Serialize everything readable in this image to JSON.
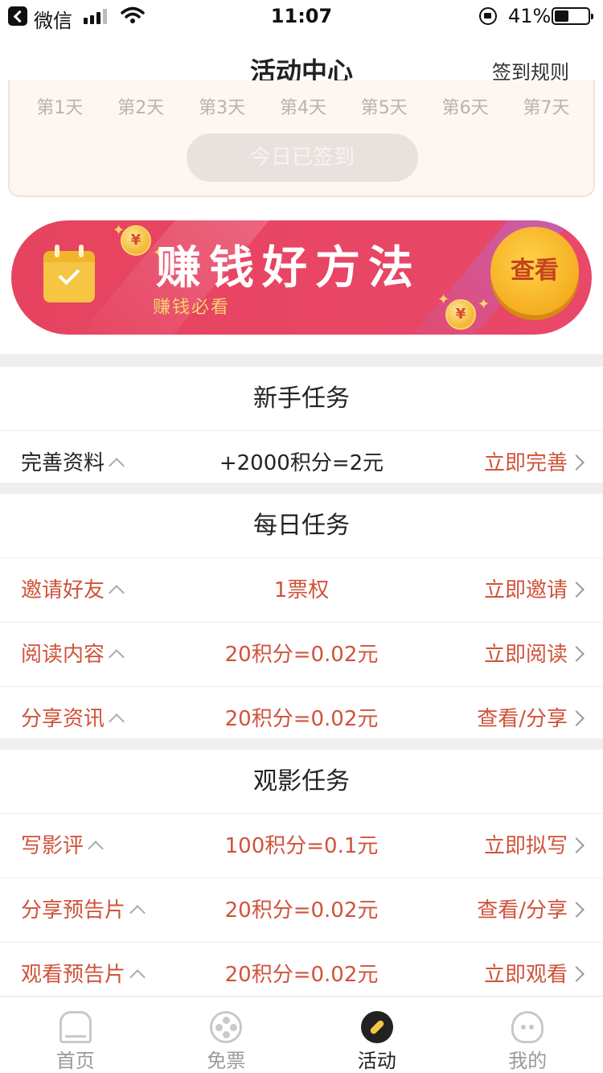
{
  "status_bar": {
    "carrier": "微信",
    "time": "11:07",
    "battery_percent": "41%"
  },
  "nav": {
    "title": "活动中心",
    "rules_link": "签到规则"
  },
  "checkin": {
    "days": [
      "第1天",
      "第2天",
      "第3天",
      "第4天",
      "第5天",
      "第6天",
      "第7天"
    ],
    "button_label": "今日已签到"
  },
  "promo": {
    "title": "赚钱好方法",
    "subtitle": "赚钱必看",
    "coin_symbol": "¥",
    "button_label": "查看"
  },
  "sections": {
    "newbie": {
      "title": "新手任务",
      "rows": [
        {
          "name": "完善资料",
          "reward": "+2000积分=2元",
          "action": "立即完善"
        }
      ]
    },
    "daily": {
      "title": "每日任务",
      "rows": [
        {
          "name": "邀请好友",
          "reward": "1票权",
          "action": "立即邀请"
        },
        {
          "name": "阅读内容",
          "reward": "20积分=0.02元",
          "action": "立即阅读"
        },
        {
          "name": "分享资讯",
          "reward": "20积分=0.02元",
          "action": "查看/分享"
        }
      ]
    },
    "movie": {
      "title": "观影任务",
      "rows": [
        {
          "name": "写影评",
          "reward": "100积分=0.1元",
          "action": "立即拟写"
        },
        {
          "name": "分享预告片",
          "reward": "20积分=0.02元",
          "action": "查看/分享"
        },
        {
          "name": "观看预告片",
          "reward": "20积分=0.02元",
          "action": "立即观看"
        }
      ]
    }
  },
  "tabs": [
    {
      "label": "首页",
      "icon": "home-icon"
    },
    {
      "label": "免票",
      "icon": "film-reel-icon"
    },
    {
      "label": "活动",
      "icon": "compass-icon",
      "active": true
    },
    {
      "label": "我的",
      "icon": "face-icon"
    }
  ],
  "colors": {
    "accent_red": "#d0533a",
    "banner_red": "#e84665",
    "gold": "#f4b531"
  }
}
